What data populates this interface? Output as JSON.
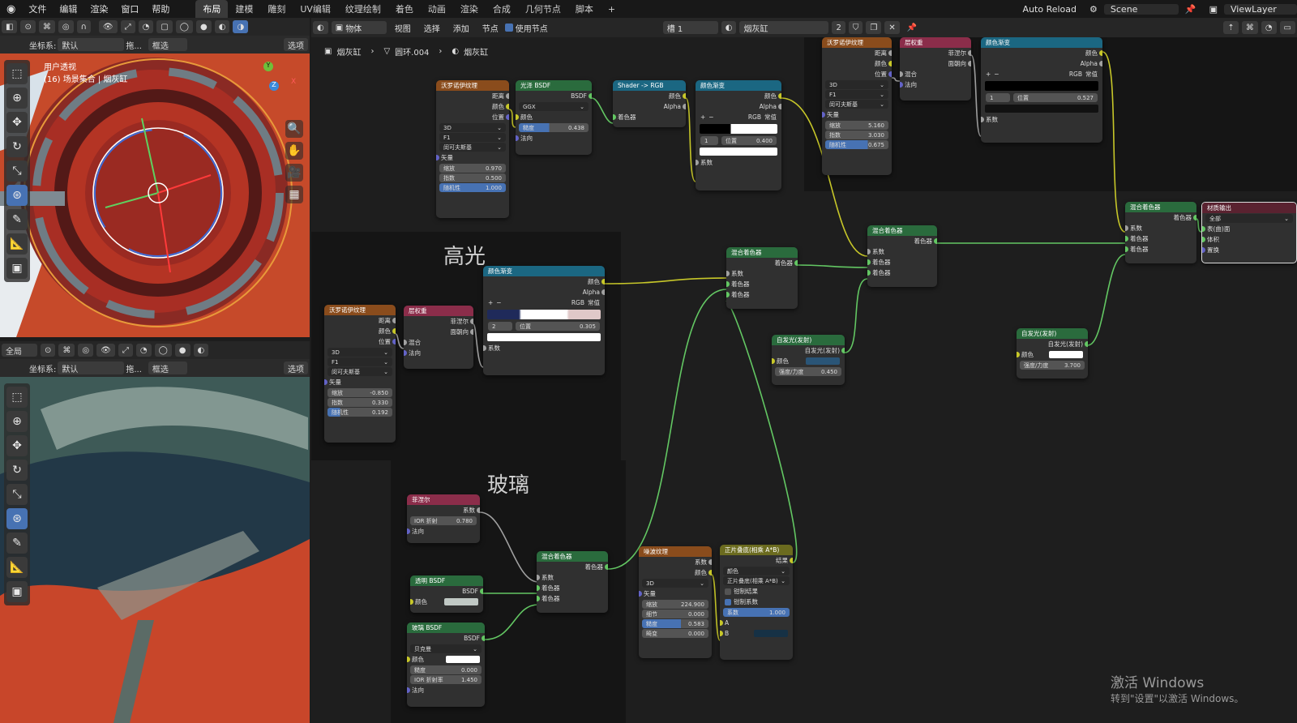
{
  "menubar": {
    "menus": [
      "文件",
      "编辑",
      "渲染",
      "窗口",
      "帮助"
    ],
    "workspaces": [
      "布局",
      "建模",
      "雕刻",
      "UV编辑",
      "纹理绘制",
      "着色",
      "动画",
      "渲染",
      "合成",
      "几何节点",
      "脚本"
    ],
    "active_workspace": "布局",
    "auto_reload": "Auto Reload",
    "scene": "Scene",
    "view_layer": "ViewLayer",
    "add_tab": "+"
  },
  "viewport_top": {
    "coord_label": "坐标系:",
    "coord_value": "默认",
    "drag_label": "拖...",
    "select_mode": "框选",
    "options": "选项",
    "view_name": "用户透视",
    "collection": "(16) 场景集合 | 烟灰缸",
    "gizmo_x": "X",
    "gizmo_y": "Y",
    "gizmo_z": "Z"
  },
  "viewport_bottom": {
    "mode": "全局",
    "coord_label": "坐标系:",
    "coord_value": "默认",
    "drag_label": "拖...",
    "select_mode": "框选",
    "options": "选项"
  },
  "node_header": {
    "mode": "物体",
    "menus": [
      "视图",
      "选择",
      "添加",
      "节点"
    ],
    "use_nodes": "使用节点",
    "slot": "槽 1",
    "material": "烟灰缸",
    "users": "2"
  },
  "breadcrumb": [
    "烟灰缸",
    "圆环.004",
    "烟灰缸"
  ],
  "frames": {
    "highlight": "高光",
    "glass": "玻璃"
  },
  "nodes": {
    "voronoi_a": {
      "title": "沃罗诺伊纹理",
      "out_distance": "距离",
      "out_color": "颜色",
      "out_position": "位置",
      "dim": "3D",
      "feature": "F1",
      "metric": "闵可夫斯基",
      "in_vector": "矢量",
      "scale_label": "缩放",
      "scale": "0.970",
      "exponent_label": "指数",
      "exponent": "0.500",
      "random_label": "随机性",
      "random": "1.000"
    },
    "glossy": {
      "title": "光泽 BSDF",
      "out": "BSDF",
      "dist": "GGX",
      "in_color": "颜色",
      "rough_label": "糙度",
      "rough": "0.438",
      "in_normal": "法向"
    },
    "shader_rgb": {
      "title": "Shader -> RGB",
      "out_color": "颜色",
      "out_alpha": "Alpha",
      "in_shader": "着色器"
    },
    "ramp_a": {
      "title": "颜色渐变",
      "out_color": "颜色",
      "out_alpha": "Alpha",
      "mode": "RGB",
      "interp": "常值",
      "index": "1",
      "pos_label": "位置",
      "pos": "0.400",
      "in_fac": "系数"
    },
    "voronoi_b": {
      "title": "沃罗诺伊纹理",
      "out_distance": "距离",
      "out_color": "颜色",
      "out_position": "位置",
      "dim": "3D",
      "feature": "F1",
      "metric": "闵可夫斯基",
      "in_vector": "矢量",
      "scale_label": "缩放",
      "scale": "5.160",
      "exponent_label": "指数",
      "exponent": "3.030",
      "random_label": "随机性",
      "random": "0.675"
    },
    "layer_weight_a": {
      "title": "层权重",
      "out_fresnel": "菲涅尔",
      "out_facing": "面朝向",
      "in_blend": "混合",
      "in_normal": "法向"
    },
    "ramp_b": {
      "title": "颜色渐变",
      "out_color": "颜色",
      "out_alpha": "Alpha",
      "mode": "RGB",
      "interp": "常值",
      "index": "1",
      "pos_label": "位置",
      "pos": "0.527",
      "in_fac": "系数"
    },
    "mix_top": {
      "title": "混合着色器",
      "out": "着色器",
      "in_fac": "系数",
      "in_s1": "着色器",
      "in_s2": "着色器"
    },
    "output": {
      "title": "材质输出",
      "target": "全部",
      "in_surface": "表(曲)面",
      "in_volume": "体积",
      "in_disp": "置换"
    },
    "mix_mid": {
      "title": "混合着色器",
      "out": "着色器",
      "in_fac": "系数",
      "in_s1": "着色器",
      "in_s2": "着色器"
    },
    "mix_center": {
      "title": "混合着色器",
      "out": "着色器",
      "in_fac": "系数",
      "in_s1": "着色器",
      "in_s2": "着色器"
    },
    "emission_a": {
      "title": "自发光(发射)",
      "out": "自发光(发射)",
      "in_color": "颜色",
      "strength_label": "强度/力度",
      "strength": "0.450"
    },
    "emission_b": {
      "title": "自发光(发射)",
      "out": "自发光(发射)",
      "in_color": "颜色",
      "strength_label": "强度/力度",
      "strength": "3.700"
    },
    "voronoi_c": {
      "title": "沃罗诺伊纹理",
      "out_distance": "距离",
      "out_color": "颜色",
      "out_position": "位置",
      "dim": "3D",
      "feature": "F1",
      "metric": "闵可夫斯基",
      "in_vector": "矢量",
      "scale_label": "缩放",
      "scale": "-0.850",
      "exponent_label": "指数",
      "exponent": "0.330",
      "random_label": "随机性",
      "random": "0.192"
    },
    "layer_weight_b": {
      "title": "层权重",
      "out_fresnel": "菲涅尔",
      "out_facing": "面朝向",
      "in_blend": "混合",
      "in_normal": "法向"
    },
    "ramp_c": {
      "title": "颜色渐变",
      "out_color": "颜色",
      "out_alpha": "Alpha",
      "mode": "RGB",
      "interp": "常值",
      "index": "2",
      "pos_label": "位置",
      "pos": "0.305",
      "in_fac": "系数"
    },
    "fresnel": {
      "title": "菲涅尔",
      "out_fac": "系数",
      "ior_label": "IOR 折射",
      "ior": "0.780",
      "in_normal": "法向"
    },
    "transparent": {
      "title": "透明 BSDF",
      "out": "BSDF",
      "in_color": "颜色"
    },
    "glass": {
      "title": "玻璃 BSDF",
      "out": "BSDF",
      "dist": "贝克曼",
      "in_color": "颜色",
      "rough_label": "糙度",
      "rough": "0.000",
      "ior_label": "IOR 折射率",
      "ior": "1.450",
      "in_normal": "法向"
    },
    "mix_glass": {
      "title": "混合着色器",
      "out": "着色器",
      "in_fac": "系数",
      "in_s1": "着色器",
      "in_s2": "着色器"
    },
    "noise": {
      "title": "噪波纹理",
      "out_fac": "系数",
      "out_color": "颜色",
      "dim": "3D",
      "in_vector": "矢量",
      "scale_label": "缩放",
      "scale": "224.900",
      "detail_label": "细节",
      "detail": "0.000",
      "rough_label": "糙度",
      "rough": "0.583",
      "distort_label": "畸变",
      "distort": "0.000"
    },
    "multiply": {
      "title": "正片叠底(相乘 A*B)",
      "out": "结果",
      "type": "颜色",
      "blend": "正片叠底(相乘 A*B)",
      "clamp_result": "钳制结果",
      "clamp_factor": "钳制系数",
      "fac_label": "系数",
      "fac": "1.000",
      "in_a": "A",
      "in_b": "B"
    }
  },
  "watermark": {
    "line1": "激活 Windows",
    "line2": "转到\"设置\"以激活 Windows。"
  },
  "colors": {
    "accent": "#4772b3",
    "texture_header": "#8a4c1c",
    "shader_header": "#2a6b3d",
    "converter_header": "#1b6782",
    "input_header": "#8b2d4a",
    "viewport_red": "#c8462a",
    "viewport_teal": "#3d5a56"
  }
}
